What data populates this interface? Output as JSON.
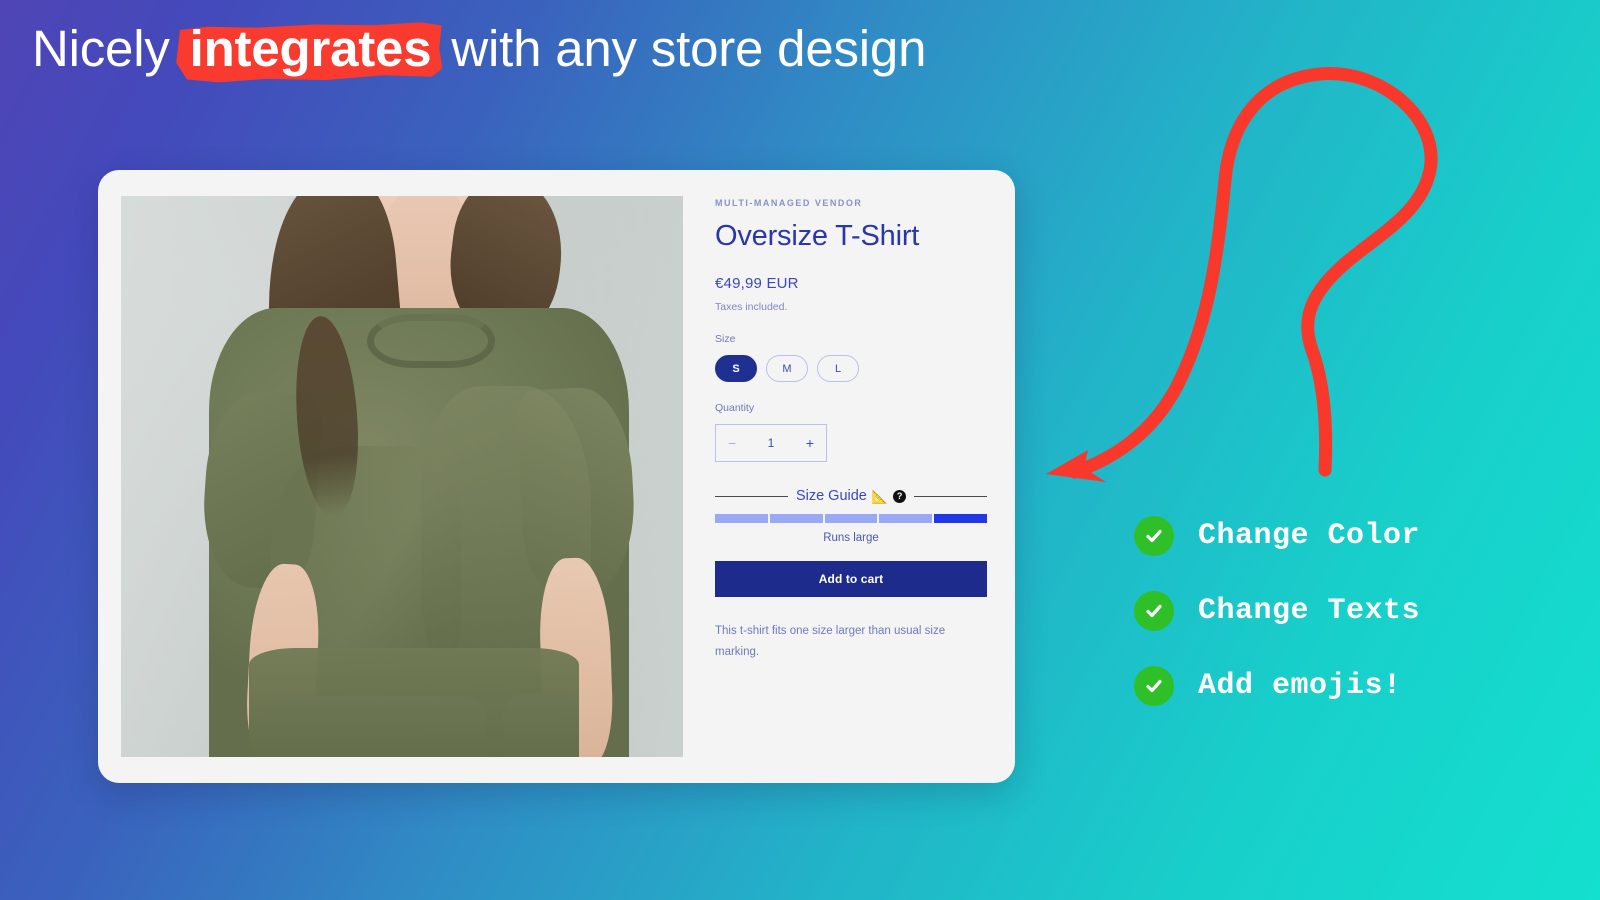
{
  "headline": {
    "before": "Nicely ",
    "highlighted": "integrates",
    "after": " with any store design",
    "highlight_color": "#f93a2f",
    "text_color": "#ffffff"
  },
  "background": {
    "gradient_from": "#4f45b6",
    "gradient_to": "#14e0cf"
  },
  "product": {
    "vendor": "MULTI-MANAGED VENDOR",
    "title": "Oversize T-Shirt",
    "price": "€49,99 EUR",
    "taxes_note": "Taxes included.",
    "size_label": "Size",
    "sizes": [
      {
        "label": "S",
        "selected": true
      },
      {
        "label": "M",
        "selected": false
      },
      {
        "label": "L",
        "selected": false
      }
    ],
    "quantity_label": "Quantity",
    "quantity_value": "1",
    "quantity_minus": "−",
    "quantity_plus": "+",
    "size_guide": {
      "title": "Size Guide",
      "ruler_icon": "📐",
      "help_icon": "?",
      "segments": 5,
      "active_segment_index": 4,
      "segment_color": "#9aa8f5",
      "active_color": "#2238e8",
      "caption": "Runs large"
    },
    "add_to_cart_label": "Add to cart",
    "add_to_cart_color": "#1d2b8c",
    "description": "This t-shirt fits one size larger than usual size marking.",
    "accent_color": "#2a37a8",
    "card_background": "#f4f4f5",
    "photo_alt": "Woman wearing olive green oversize t-shirt"
  },
  "annotation": {
    "arrow_color": "#f9382c",
    "arrow_points_to": "product-card"
  },
  "checklist": {
    "check_color": "#2fbf28",
    "items": [
      {
        "label": "Change Color"
      },
      {
        "label": "Change Texts"
      },
      {
        "label": "Add emojis!"
      }
    ]
  }
}
